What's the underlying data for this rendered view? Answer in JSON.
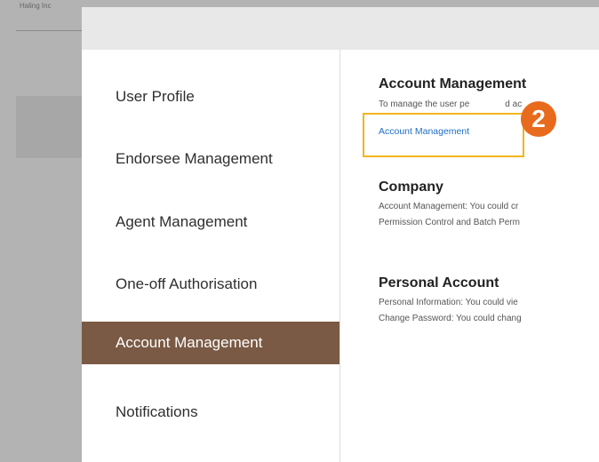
{
  "background": {
    "top_text": "Haling Inc"
  },
  "menu": {
    "items": [
      {
        "label": "User Profile",
        "active": false
      },
      {
        "label": "Endorsee Management",
        "active": false
      },
      {
        "label": "Agent Management",
        "active": false
      },
      {
        "label": "One-off Authorisation",
        "active": false
      },
      {
        "label": "Account Management",
        "active": true
      },
      {
        "label": "Notifications",
        "active": false
      }
    ]
  },
  "content": {
    "account_management": {
      "title": "Account Management",
      "description": "To manage the user pe",
      "description_tail": "d ac",
      "link": "Account Management"
    },
    "company": {
      "title": "Company",
      "lines": [
        "Account Management: You could cr",
        "Permission Control and Batch Perm"
      ]
    },
    "personal_account": {
      "title": "Personal Account",
      "lines": [
        "Personal Information: You could vie",
        "Change Password: You could chang"
      ]
    }
  },
  "annotation": {
    "step": "2"
  },
  "colors": {
    "active_bg": "#7a5a44",
    "link": "#1f6fc5",
    "highlight": "#f3b51c",
    "badge": "#e86a1d"
  }
}
